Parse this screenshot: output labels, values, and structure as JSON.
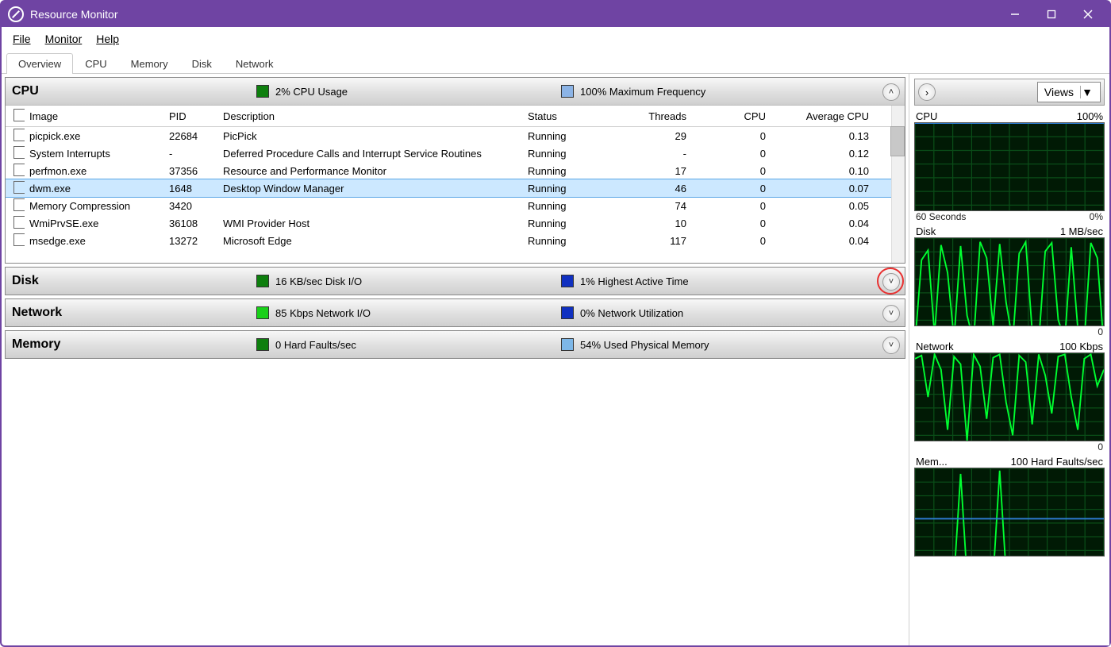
{
  "window": {
    "title": "Resource Monitor"
  },
  "menubar": [
    "File",
    "Monitor",
    "Help"
  ],
  "tabs": [
    "Overview",
    "CPU",
    "Memory",
    "Disk",
    "Network"
  ],
  "active_tab": 0,
  "sections": {
    "cpu": {
      "title": "CPU",
      "stat1": {
        "color": "#0e7f0e",
        "label": "2% CPU Usage"
      },
      "stat2": {
        "color": "#8cb4e6",
        "label": "100% Maximum Frequency"
      },
      "collapsed": false
    },
    "disk": {
      "title": "Disk",
      "stat1": {
        "color": "#0e7f0e",
        "label": "16 KB/sec Disk I/O"
      },
      "stat2": {
        "color": "#1030c0",
        "label": "1% Highest Active Time"
      },
      "collapsed": true
    },
    "network": {
      "title": "Network",
      "stat1": {
        "color": "#18d018",
        "label": "85 Kbps Network I/O"
      },
      "stat2": {
        "color": "#1030c0",
        "label": "0% Network Utilization"
      },
      "collapsed": true
    },
    "memory": {
      "title": "Memory",
      "stat1": {
        "color": "#0e7f0e",
        "label": "0 Hard Faults/sec"
      },
      "stat2": {
        "color": "#7db7e8",
        "label": "54% Used Physical Memory"
      },
      "collapsed": true
    }
  },
  "cpu_table": {
    "columns": [
      "Image",
      "PID",
      "Description",
      "Status",
      "Threads",
      "CPU",
      "Average CPU"
    ],
    "selected_index": 3,
    "rows": [
      {
        "image": "picpick.exe",
        "pid": "22684",
        "desc": "PicPick",
        "status": "Running",
        "threads": 29,
        "cpu": 0,
        "avg": "0.13"
      },
      {
        "image": "System Interrupts",
        "pid": "-",
        "desc": "Deferred Procedure Calls and Interrupt Service Routines",
        "status": "Running",
        "threads": "-",
        "cpu": 0,
        "avg": "0.12"
      },
      {
        "image": "perfmon.exe",
        "pid": "37356",
        "desc": "Resource and Performance Monitor",
        "status": "Running",
        "threads": 17,
        "cpu": 0,
        "avg": "0.10"
      },
      {
        "image": "dwm.exe",
        "pid": "1648",
        "desc": "Desktop Window Manager",
        "status": "Running",
        "threads": 46,
        "cpu": 0,
        "avg": "0.07"
      },
      {
        "image": "Memory Compression",
        "pid": "3420",
        "desc": "",
        "status": "Running",
        "threads": 74,
        "cpu": 0,
        "avg": "0.05"
      },
      {
        "image": "WmiPrvSE.exe",
        "pid": "36108",
        "desc": "WMI Provider Host",
        "status": "Running",
        "threads": 10,
        "cpu": 0,
        "avg": "0.04"
      },
      {
        "image": "msedge.exe",
        "pid": "13272",
        "desc": "Microsoft Edge",
        "status": "Running",
        "threads": 117,
        "cpu": 0,
        "avg": "0.04"
      }
    ]
  },
  "sidepanel": {
    "views_label": "Views",
    "charts": [
      {
        "title": "CPU",
        "right": "100%",
        "footer_left": "60 Seconds",
        "footer_right": "0%"
      },
      {
        "title": "Disk",
        "right": "1 MB/sec",
        "footer_left": "",
        "footer_right": "0"
      },
      {
        "title": "Network",
        "right": "100 Kbps",
        "footer_left": "",
        "footer_right": "0"
      },
      {
        "title": "Mem...",
        "right": "100 Hard Faults/sec",
        "footer_left": "",
        "footer_right": ""
      }
    ]
  },
  "chart_data": [
    {
      "type": "line",
      "title": "CPU",
      "ylim": [
        0,
        100
      ],
      "x_seconds": 60,
      "series": [
        {
          "name": "CPU Usage",
          "color": "#00ff30",
          "values": [
            2,
            3,
            2,
            4,
            3,
            2,
            5,
            3,
            2,
            2,
            3,
            4,
            2,
            3,
            2,
            2,
            3,
            2,
            4,
            3,
            2,
            3,
            2,
            2,
            3,
            2,
            4,
            3,
            2,
            2
          ]
        },
        {
          "name": "Maximum Frequency",
          "color": "#2e7dd6",
          "values": [
            100,
            100,
            100,
            100,
            100,
            100,
            100,
            100,
            100,
            100,
            100,
            100,
            100,
            100,
            100,
            100,
            100,
            100,
            100,
            100,
            100,
            100,
            100,
            100,
            100,
            100,
            100,
            100,
            100,
            100
          ]
        }
      ]
    },
    {
      "type": "line",
      "title": "Disk",
      "ylim": [
        0,
        1024
      ],
      "units": "KB/sec",
      "x_seconds": 60,
      "series": [
        {
          "name": "Disk I/O",
          "color": "#00ff30",
          "values": [
            40,
            820,
            910,
            120,
            960,
            700,
            80,
            950,
            300,
            60,
            990,
            840,
            200,
            970,
            420,
            60,
            880,
            990,
            150,
            50,
            900,
            980,
            260,
            70,
            940,
            180,
            60,
            980,
            840,
            16
          ]
        },
        {
          "name": "Highest Active Time %",
          "color": "#2e7dd6",
          "values": [
            1,
            3,
            4,
            1,
            5,
            2,
            1,
            4,
            2,
            1,
            5,
            3,
            1,
            4,
            2,
            1,
            3,
            5,
            1,
            1,
            4,
            5,
            2,
            1,
            4,
            1,
            1,
            5,
            3,
            1
          ]
        }
      ]
    },
    {
      "type": "line",
      "title": "Network",
      "ylim": [
        0,
        100
      ],
      "units": "Kbps",
      "x_seconds": 60,
      "series": [
        {
          "name": "Network I/O",
          "color": "#00ff30",
          "values": [
            95,
            98,
            60,
            99,
            85,
            30,
            97,
            90,
            20,
            99,
            88,
            40,
            96,
            99,
            55,
            25,
            98,
            92,
            35,
            99,
            80,
            45,
            97,
            99,
            60,
            30,
            95,
            99,
            70,
            85
          ]
        },
        {
          "name": "Network Utilization %",
          "color": "#2e7dd6",
          "values": [
            0,
            0,
            0,
            0,
            0,
            0,
            0,
            0,
            0,
            0,
            0,
            0,
            0,
            0,
            0,
            0,
            0,
            0,
            0,
            0,
            0,
            0,
            0,
            0,
            0,
            0,
            0,
            0,
            0,
            0
          ]
        }
      ]
    },
    {
      "type": "line",
      "title": "Memory",
      "ylim": [
        0,
        100
      ],
      "units": "Hard Faults/sec",
      "x_seconds": 60,
      "series": [
        {
          "name": "Hard Faults/sec",
          "color": "#00ff30",
          "values": [
            0,
            0,
            5,
            0,
            0,
            3,
            0,
            95,
            0,
            0,
            2,
            0,
            0,
            98,
            4,
            0,
            0,
            0,
            6,
            0,
            0,
            0,
            3,
            0,
            0,
            0,
            5,
            0,
            0,
            0
          ]
        },
        {
          "name": "Used Physical Memory %",
          "color": "#2e7dd6",
          "values": [
            54,
            54,
            54,
            54,
            54,
            54,
            54,
            54,
            54,
            54,
            54,
            54,
            54,
            54,
            54,
            54,
            54,
            54,
            54,
            54,
            54,
            54,
            54,
            54,
            54,
            54,
            54,
            54,
            54,
            54
          ]
        }
      ]
    }
  ]
}
